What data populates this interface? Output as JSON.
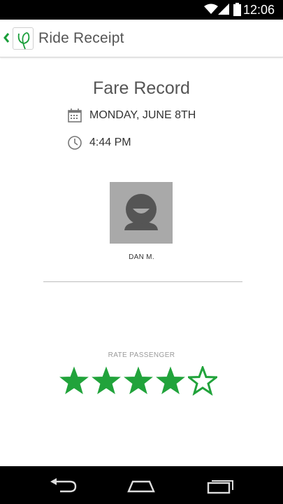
{
  "status_bar": {
    "time": "12:06",
    "icons": [
      "wifi-icon",
      "signal-icon",
      "battery-icon"
    ]
  },
  "app_bar": {
    "title": "Ride Receipt",
    "back_icon": "chevron-left-icon",
    "logo_icon": "app-logo-icon",
    "accent_color": "#1a9e3a"
  },
  "receipt": {
    "title": "Fare Record",
    "date": "MONDAY, JUNE 8TH",
    "time": "4:44 PM",
    "date_icon": "calendar-icon",
    "time_icon": "clock-icon"
  },
  "passenger": {
    "name": "DAN M.",
    "avatar_icon": "person-avatar-icon"
  },
  "rating": {
    "label": "RATE PASSENGER",
    "value": 4,
    "max": 5,
    "star_color": "#21a33b"
  },
  "nav_bar": {
    "buttons": [
      "back-icon",
      "home-icon",
      "recent-apps-icon"
    ]
  }
}
